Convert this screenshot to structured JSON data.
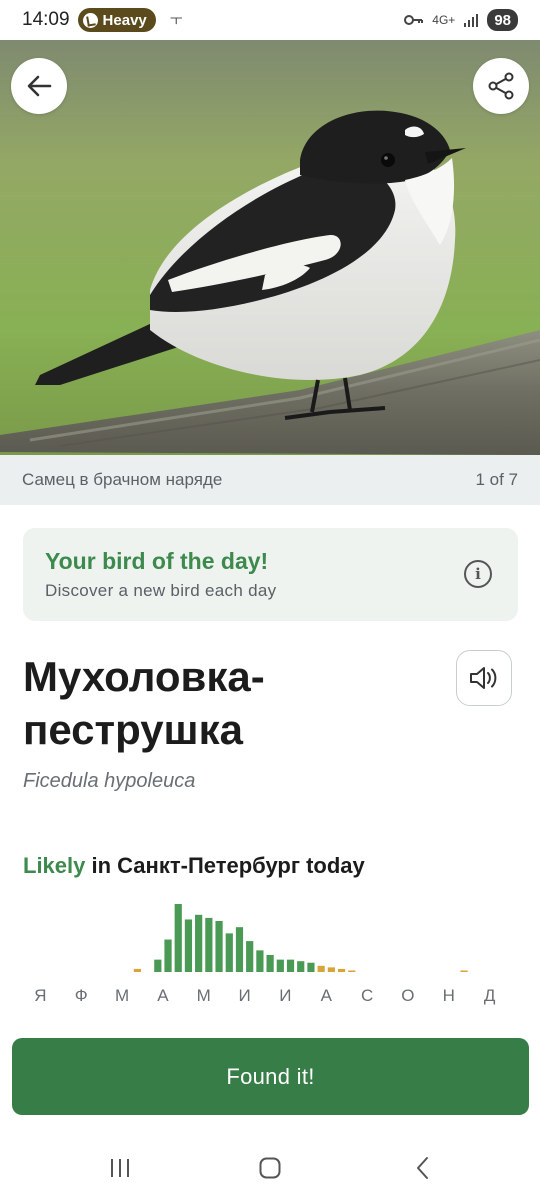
{
  "status_bar": {
    "time": "14:09",
    "media_pill": "Heavy",
    "extra_glyph": "ㅜ",
    "network": "4G+",
    "battery": "98"
  },
  "hero": {
    "caption": "Самец в брачном наряде",
    "counter": "1 of 7"
  },
  "bird_of_day": {
    "title": "Your bird of the day!",
    "subtitle": "Discover a new bird each day"
  },
  "bird": {
    "common_name_line1": "Мухоловка-",
    "common_name_line2": "пеструшка",
    "scientific_name": "Ficedula hypoleuca"
  },
  "likelihood": {
    "likely": "Likely",
    "rest": " in Санкт-Петербург today"
  },
  "chart_data": {
    "type": "bar",
    "title": "",
    "months": [
      "Я",
      "Ф",
      "М",
      "А",
      "М",
      "И",
      "И",
      "А",
      "С",
      "О",
      "Н",
      "Д"
    ],
    "weeks_per_month": 4,
    "values": [
      0,
      0,
      0,
      0,
      0,
      0,
      0,
      0,
      0,
      0,
      0,
      0.02,
      0,
      0.08,
      0.21,
      0.44,
      0.34,
      0.37,
      0.35,
      0.33,
      0.25,
      0.29,
      0.2,
      0.14,
      0.11,
      0.08,
      0.08,
      0.07,
      0.06,
      0.04,
      0.03,
      0.02,
      0.01,
      0,
      0,
      0,
      0,
      0,
      0,
      0,
      0,
      0,
      0,
      0.01,
      0,
      0,
      0,
      0
    ],
    "colors": {
      "common": "#4a9a55",
      "rare": "#d8a53a"
    },
    "ylim": [
      0,
      0.44
    ]
  },
  "actions": {
    "found_it": "Found it!"
  },
  "colors": {
    "accent_green": "#3e8a4e",
    "button_green": "#377d47",
    "card_bg": "#eef3f0"
  },
  "icons": {
    "back": "arrow-left-icon",
    "share": "share-icon",
    "info": "info-icon",
    "sound": "speaker-icon"
  }
}
